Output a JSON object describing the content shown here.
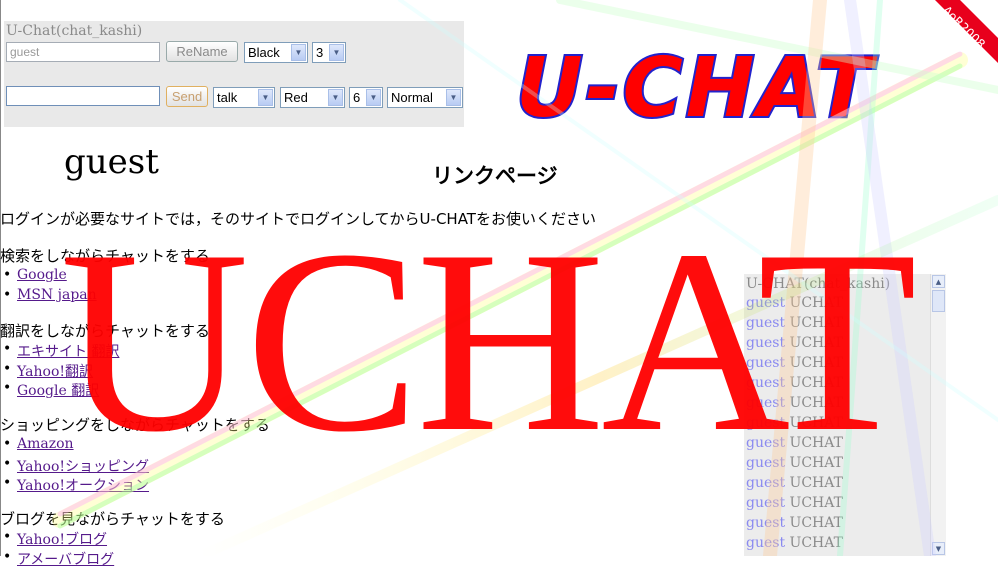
{
  "panel": {
    "title": "U-Chat(chat_kashi)",
    "name_value": "guest",
    "rename_label": "ReName",
    "name_color": "Black",
    "name_size": "3",
    "message_value": "",
    "send_label": "Send",
    "mode": "talk",
    "msg_color": "Red",
    "msg_size": "6",
    "style": "Normal"
  },
  "logo": {
    "text": "U-CHAT",
    "fill": "#ff0000",
    "stroke": "#2222cc"
  },
  "ribbon": {
    "text": "AoR2008",
    "color": "#e8001c"
  },
  "overlay": {
    "text": "UCHAT",
    "color": "#ff0000"
  },
  "user": {
    "name": "guest"
  },
  "page_title": "リンクページ",
  "notice": "ログインが必要なサイトでは，そのサイトでログインしてからU-CHATをお使いください",
  "sections": [
    {
      "heading": "検索をしながらチャットをする",
      "links": [
        "Google",
        "MSN japan"
      ]
    },
    {
      "heading": "翻訳をしながらチャットをする",
      "links": [
        "エキサイト 翻訳",
        "Yahoo!翻訳",
        "Google 翻訳"
      ]
    },
    {
      "heading": "ショッピングをしながらチャットをする",
      "links": [
        "Amazon",
        "Yahoo!ショッピング",
        "Yahoo!オークション"
      ]
    },
    {
      "heading": "ブログを見ながらチャットをする",
      "links": [
        "Yahoo!ブログ",
        "アメーバブログ"
      ]
    }
  ],
  "chat_log": {
    "title": "U-CHAT(chat_kashi)",
    "lines": [
      {
        "who": "guest",
        "msg": "UCHAT"
      },
      {
        "who": "guest",
        "msg": "UCHAT"
      },
      {
        "who": "guest",
        "msg": "UCHAT"
      },
      {
        "who": "guest",
        "msg": "UCHAT"
      },
      {
        "who": "guest",
        "msg": "UCHAT"
      },
      {
        "who": "guest",
        "msg": "UCHAT"
      },
      {
        "who": "guest",
        "msg": "UCHAT"
      },
      {
        "who": "guest",
        "msg": "UCHAT"
      },
      {
        "who": "guest",
        "msg": "UCHAT"
      },
      {
        "who": "guest",
        "msg": "UCHAT"
      },
      {
        "who": "guest",
        "msg": "UCHAT"
      },
      {
        "who": "guest",
        "msg": "UCHAT"
      },
      {
        "who": "guest",
        "msg": "UCHAT"
      }
    ]
  }
}
